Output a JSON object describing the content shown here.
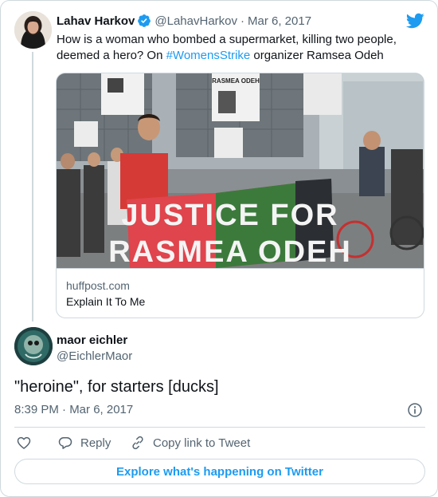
{
  "parent_tweet": {
    "author_name": "Lahav Harkov",
    "author_handle": "@LahavHarkov",
    "separator": "·",
    "date": "Mar 6, 2017",
    "text_before": "How is a woman who bombed a supermarket, killing two people, deemed a hero? On ",
    "hashtag": "#WomensStrike",
    "text_after": " organizer Ramsea Odeh",
    "link_card": {
      "domain": "huffpost.com",
      "title": "Explain It To Me",
      "banner_text_line1": "JUSTICE FOR",
      "banner_text_line2": "RASMEA ODEH",
      "sign_text": "RASMEA ODEH"
    }
  },
  "reply_tweet": {
    "author_name": "maor eichler",
    "author_handle": "@EichlerMaor",
    "text": "\"heroine\", for starters [ducks]",
    "timestamp": "8:39 PM · Mar 6, 2017"
  },
  "actions": {
    "like_icon": "heart-icon",
    "reply_label": "Reply",
    "copy_label": "Copy link to Tweet"
  },
  "footer": {
    "explore_label": "Explore what's happening on Twitter"
  },
  "colors": {
    "twitter_blue": "#1d9bf0",
    "text_primary": "#0f1419",
    "text_secondary": "#536471",
    "border": "#cfd9de"
  }
}
